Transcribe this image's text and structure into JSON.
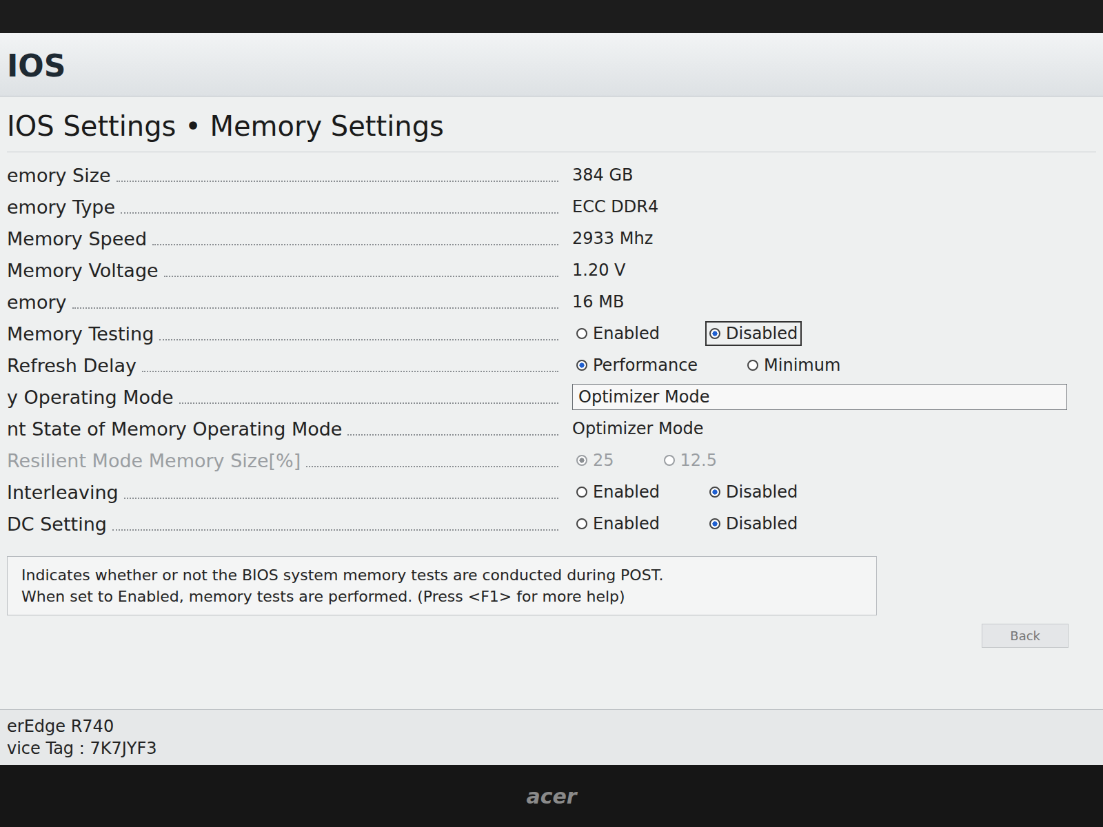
{
  "header": {
    "title": "IOS"
  },
  "page": {
    "title": "IOS Settings • Memory Settings"
  },
  "rows": [
    {
      "kind": "text",
      "label": "emory Size",
      "value": "384 GB",
      "disabled": false
    },
    {
      "kind": "text",
      "label": "emory Type",
      "value": "ECC DDR4",
      "disabled": false
    },
    {
      "kind": "text",
      "label": "Memory Speed",
      "value": "2933 Mhz",
      "disabled": false
    },
    {
      "kind": "text",
      "label": "Memory Voltage",
      "value": "1.20 V",
      "disabled": false
    },
    {
      "kind": "text",
      "label": "emory",
      "value": "16 MB",
      "disabled": false
    },
    {
      "kind": "radio",
      "label": "Memory Testing",
      "disabled": false,
      "options": [
        {
          "label": "Enabled",
          "selected": false,
          "focused": false
        },
        {
          "label": "Disabled",
          "selected": true,
          "focused": true
        }
      ]
    },
    {
      "kind": "radio",
      "label": "Refresh Delay",
      "disabled": false,
      "options": [
        {
          "label": "Performance",
          "selected": true,
          "focused": false
        },
        {
          "label": "Minimum",
          "selected": false,
          "focused": false
        }
      ]
    },
    {
      "kind": "select",
      "label": "y Operating Mode",
      "value": "Optimizer Mode",
      "disabled": false
    },
    {
      "kind": "text",
      "label": "nt State of Memory Operating Mode",
      "value": "Optimizer Mode",
      "disabled": false
    },
    {
      "kind": "radio",
      "label": "Resilient Mode Memory Size[%]",
      "disabled": true,
      "options": [
        {
          "label": "25",
          "selected": true,
          "focused": false
        },
        {
          "label": "12.5",
          "selected": false,
          "focused": false
        }
      ]
    },
    {
      "kind": "radio",
      "label": "Interleaving",
      "disabled": false,
      "options": [
        {
          "label": "Enabled",
          "selected": false,
          "focused": false
        },
        {
          "label": "Disabled",
          "selected": true,
          "focused": false
        }
      ]
    },
    {
      "kind": "radio",
      "label": "DC Setting",
      "disabled": false,
      "options": [
        {
          "label": "Enabled",
          "selected": false,
          "focused": false
        },
        {
          "label": "Disabled",
          "selected": true,
          "focused": false
        }
      ]
    }
  ],
  "help": {
    "lines": [
      "Indicates whether or not the BIOS system memory tests are conducted during POST.",
      "When set to Enabled, memory tests are performed. (Press <F1> for more help)"
    ]
  },
  "back_button": {
    "label": "Back"
  },
  "footer": {
    "model": "erEdge R740",
    "service_tag": "vice Tag : 7K7JYF3"
  },
  "bezel": {
    "brand": "acer"
  }
}
